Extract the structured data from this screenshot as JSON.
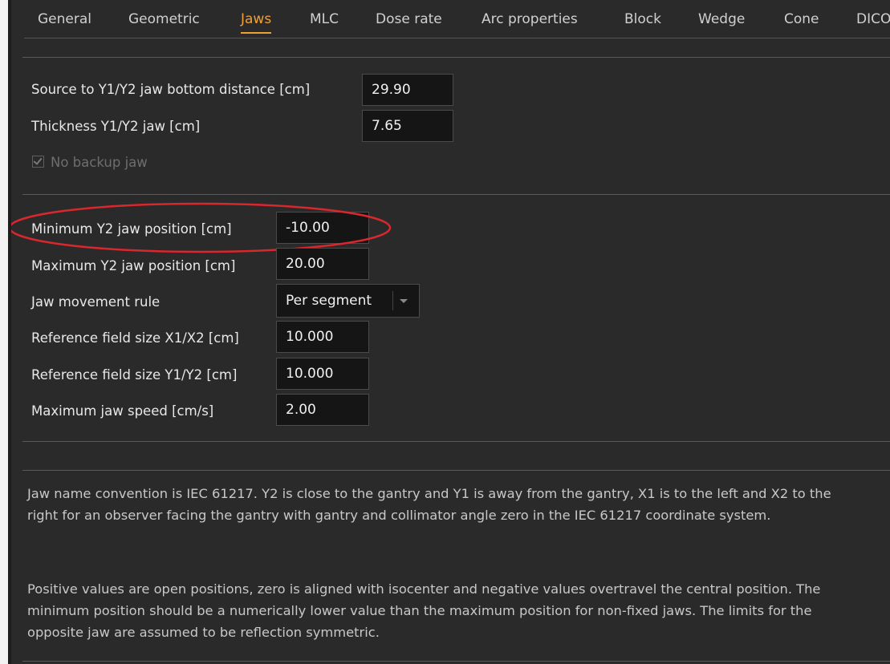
{
  "tabs": [
    {
      "label": "General",
      "active": false
    },
    {
      "label": "Geometric",
      "active": false
    },
    {
      "label": "Jaws",
      "active": true
    },
    {
      "label": "MLC",
      "active": false
    },
    {
      "label": "Dose rate",
      "active": false
    },
    {
      "label": "Arc properties",
      "active": false
    },
    {
      "label": "Block",
      "active": false
    },
    {
      "label": "Wedge",
      "active": false
    },
    {
      "label": "Cone",
      "active": false
    },
    {
      "label": "DICO",
      "active": false
    }
  ],
  "section1": {
    "source_to_jaw_label": "Source to Y1/Y2 jaw bottom distance [cm]",
    "source_to_jaw_value": "29.90",
    "thickness_label": "Thickness Y1/Y2 jaw [cm]",
    "thickness_value": "7.65",
    "no_backup_jaw_label": "No backup jaw",
    "no_backup_jaw_checked": true,
    "no_backup_jaw_disabled": true
  },
  "section2": {
    "min_y2_label": "Minimum Y2 jaw position [cm]",
    "min_y2_value": "-10.00",
    "max_y2_label": "Maximum Y2 jaw position [cm]",
    "max_y2_value": "20.00",
    "movement_rule_label": "Jaw movement rule",
    "movement_rule_value": "Per segment",
    "ref_x_label": "Reference field size X1/X2 [cm]",
    "ref_x_value": "10.000",
    "ref_y_label": "Reference field size Y1/Y2 [cm]",
    "ref_y_value": "10.000",
    "max_speed_label": "Maximum jaw speed [cm/s]",
    "max_speed_value": "2.00"
  },
  "info": {
    "paragraph1": "Jaw name convention is IEC 61217. Y2 is close to the gantry and Y1 is away from the gantry, X1 is to the left and X2 to the right for an observer facing the gantry with gantry and collimator angle zero in the IEC 61217 coordinate system.",
    "paragraph2": "Positive values are open positions, zero is aligned with isocenter and negative values overtravel the central position. The minimum position should be a numerically lower value than the maximum position for non-fixed jaws. The limits for the opposite jaw are assumed to be reflection symmetric."
  },
  "colors": {
    "panel_background": "#2a2a2a",
    "active_tab": "#f1a035",
    "highlight_annotation": "#d9272e",
    "field_background": "#151515"
  }
}
